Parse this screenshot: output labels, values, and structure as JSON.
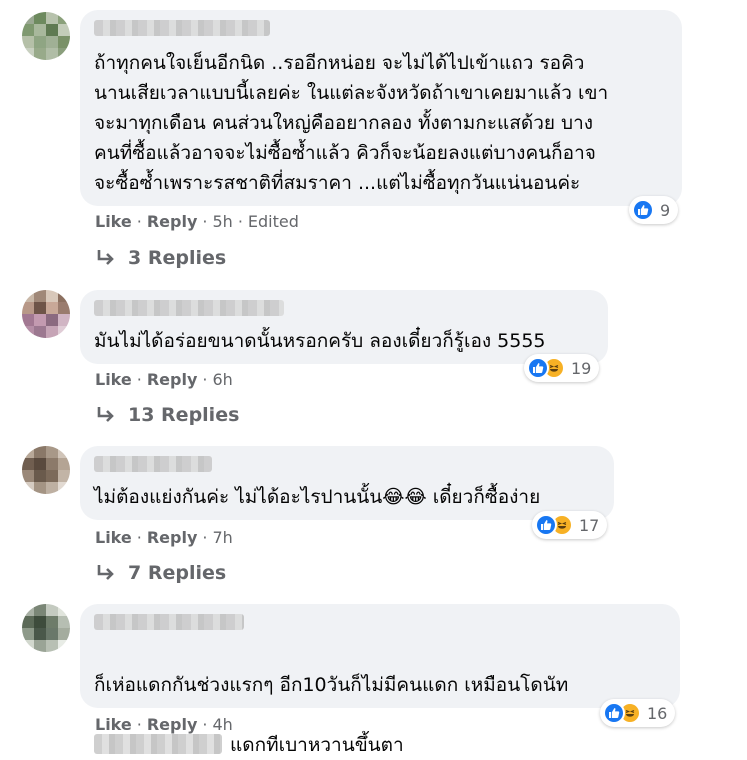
{
  "comments": [
    {
      "text": "ถ้าทุกคนใจเย็นอีกนิด ..รออีกหน่อย จะไม่ได้ไปเข้าแถว รอคิว\nนานเสียเวลาแบบนี้เลยค่ะ ในแต่ละจังหวัดถ้าเขาเคยมาแล้ว เขา\nจะมาทุกเดือน คนส่วนใหญ่คืออยากลอง ทั้งตามกะแสด้วย บาง\nคนที่ซื้อแล้วอาจจะไม่ซื้อซ้ำแล้ว คิวก็จะน้อยลงแต่บางคนก็อาจ\nจะซื้อซ้ำเพราะรสชาติที่สมราคา ...แต่ไม่ซื้อทุกวันแน่นอนค่ะ",
      "like_label": "Like",
      "reply_label": "Reply",
      "time": "5h",
      "edited": "Edited",
      "reaction_count": "9",
      "replies": "3 Replies"
    },
    {
      "text": "มันไม่ได้อร่อยขนาดนั้นหรอกครับ ลองเดี๋ยวก็รู้เอง 5555",
      "like_label": "Like",
      "reply_label": "Reply",
      "time": "6h",
      "reaction_count": "19",
      "replies": "13 Replies"
    },
    {
      "text": "ไม่ต้องแย่งกันค่ะ ไม่ได้อะไรปานนั้น😂😂 เดี๋ยวก็ซื้อง่าย",
      "like_label": "Like",
      "reply_label": "Reply",
      "time": "7h",
      "reaction_count": "17",
      "replies": "7 Replies"
    },
    {
      "text_line1": "ก็เห่อแดกกันช่วงแรกๆ อีก10วันก็ไม่มีคนแดก เหมือนโดนัท",
      "text_line2": "แดกทีเบาหวานขึ้นตา",
      "like_label": "Like",
      "reply_label": "Reply",
      "time": "4h",
      "reaction_count": "16"
    }
  ],
  "icons": {
    "like": "like-reaction-icon",
    "haha": "haha-reaction-icon",
    "reply_arrow": "reply-arrow-icon"
  },
  "colors": {
    "bubble": "#f0f2f5",
    "meta_text": "#65676b",
    "like_blue": "#1877f2",
    "haha_yellow": "#f7b125"
  }
}
